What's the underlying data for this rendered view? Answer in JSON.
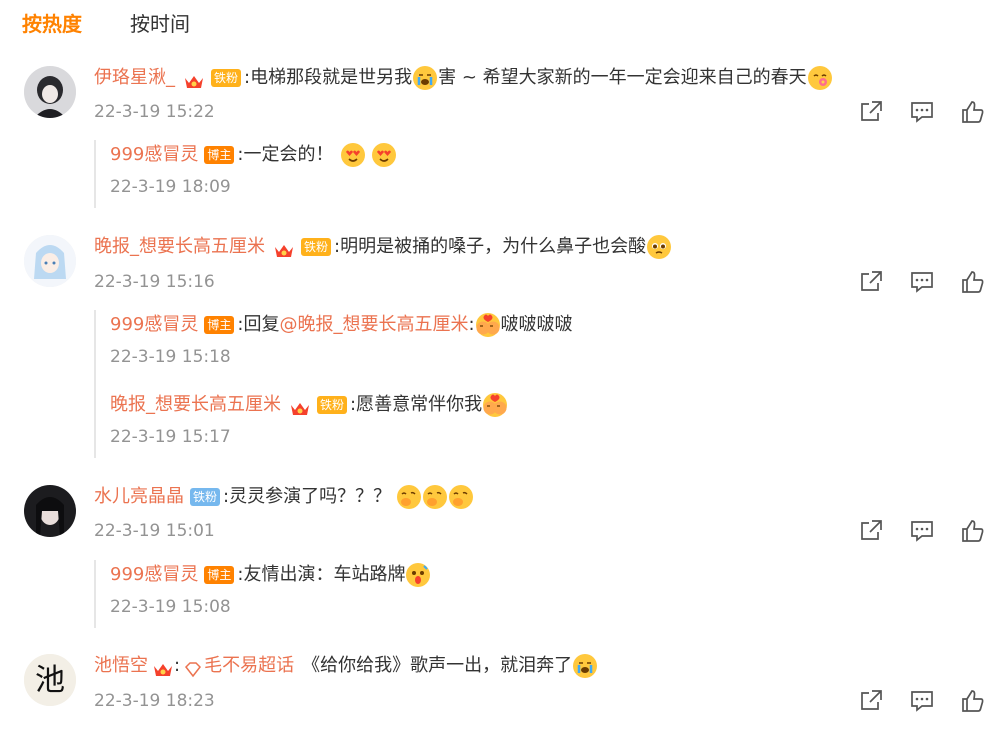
{
  "tabs": [
    "按热度",
    "按时间"
  ],
  "comments": [
    {
      "name": "伊珞星湫_",
      "fan_badge": "铁粉",
      "text_a": ":电梯那段就是世另我",
      "text_b": "害 ~ 希望大家新的一年一定会迎来自己的春天",
      "time": "22-3-19 15:22",
      "replies": [
        {
          "name": "999感冒灵",
          "badge": "博主",
          "text": ":一定会的！",
          "time": "22-3-19 18:09"
        }
      ]
    },
    {
      "name": "晚报_想要长高五厘米",
      "fan_badge": "铁粉",
      "text_a": ":明明是被捅的嗓子，为什么鼻子也会酸",
      "time": "22-3-19 15:16",
      "replies": [
        {
          "name": "999感冒灵",
          "badge": "博主",
          "text_pre": ":回复",
          "mention": "@晚报_想要长高五厘米",
          "text_post": ":",
          "text_tail": "啵啵啵啵",
          "time": "22-3-19 15:18"
        },
        {
          "name": "晚报_想要长高五厘米",
          "badge": "铁粉",
          "text": ":愿善意常伴你我",
          "time": "22-3-19 15:17"
        }
      ]
    },
    {
      "name": "水儿亮晶晶",
      "fan_badge": "铁粉",
      "text_a": ":灵灵参演了吗？？？",
      "time": "22-3-19 15:01",
      "replies": [
        {
          "name": "999感冒灵",
          "badge": "博主",
          "text": ":友情出演：车站路牌",
          "time": "22-3-19 15:08"
        }
      ]
    },
    {
      "name": "池悟空",
      "avatar_char": "池",
      "super_topic": "毛不易超话",
      "text_a": "《给你给我》歌声一出，就泪奔了",
      "time": "22-3-19 18:23"
    }
  ],
  "colors": {
    "accent": "#ff8200",
    "name": "#eb7350",
    "time": "#939393",
    "text": "#333333"
  },
  "icons": [
    "share-icon",
    "comment-icon",
    "like-icon"
  ]
}
